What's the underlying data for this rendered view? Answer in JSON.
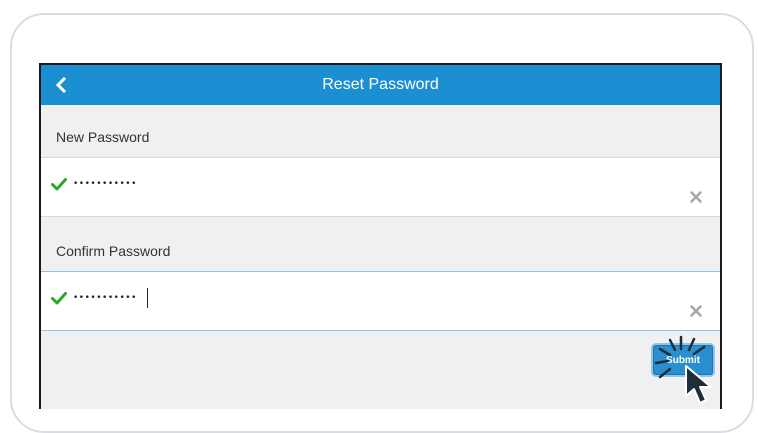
{
  "header": {
    "title": "Reset Password",
    "back_icon": "chevron-left-icon"
  },
  "new_password": {
    "label": "New Password",
    "value": "•••••••••••",
    "valid": true,
    "clear_icon": "close-icon"
  },
  "confirm_password": {
    "label": "Confirm Password",
    "value": "•••••••••••",
    "valid": true,
    "focused": true,
    "clear_icon": "close-icon"
  },
  "submit": {
    "label": "Submit"
  },
  "colors": {
    "header_bg": "#1b8fd2",
    "valid_check": "#2fa52f",
    "submit_bg": "#2a8fd0"
  }
}
